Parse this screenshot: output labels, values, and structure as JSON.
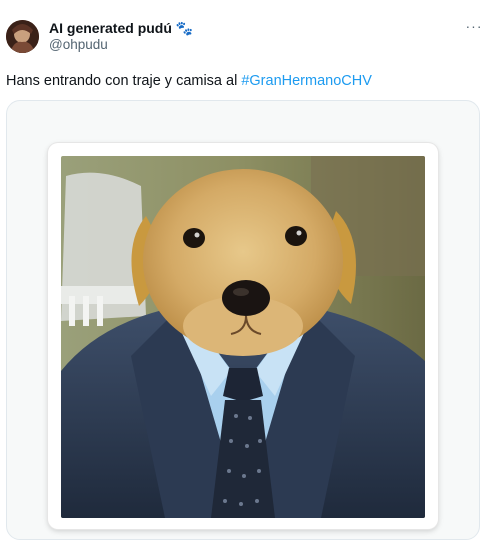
{
  "author": {
    "display_name": "AI generated pudú 🐾",
    "handle": "@ohpudu"
  },
  "tweet": {
    "text_prefix": "Hans entrando con traje y camisa al ",
    "hashtag": "#GranHermanoCHV"
  },
  "more_label": "···",
  "media": {
    "description_icon": "dog-in-suit-photo"
  },
  "colors": {
    "link": "#1d9bf0",
    "muted": "#536471",
    "text": "#0f1419"
  }
}
